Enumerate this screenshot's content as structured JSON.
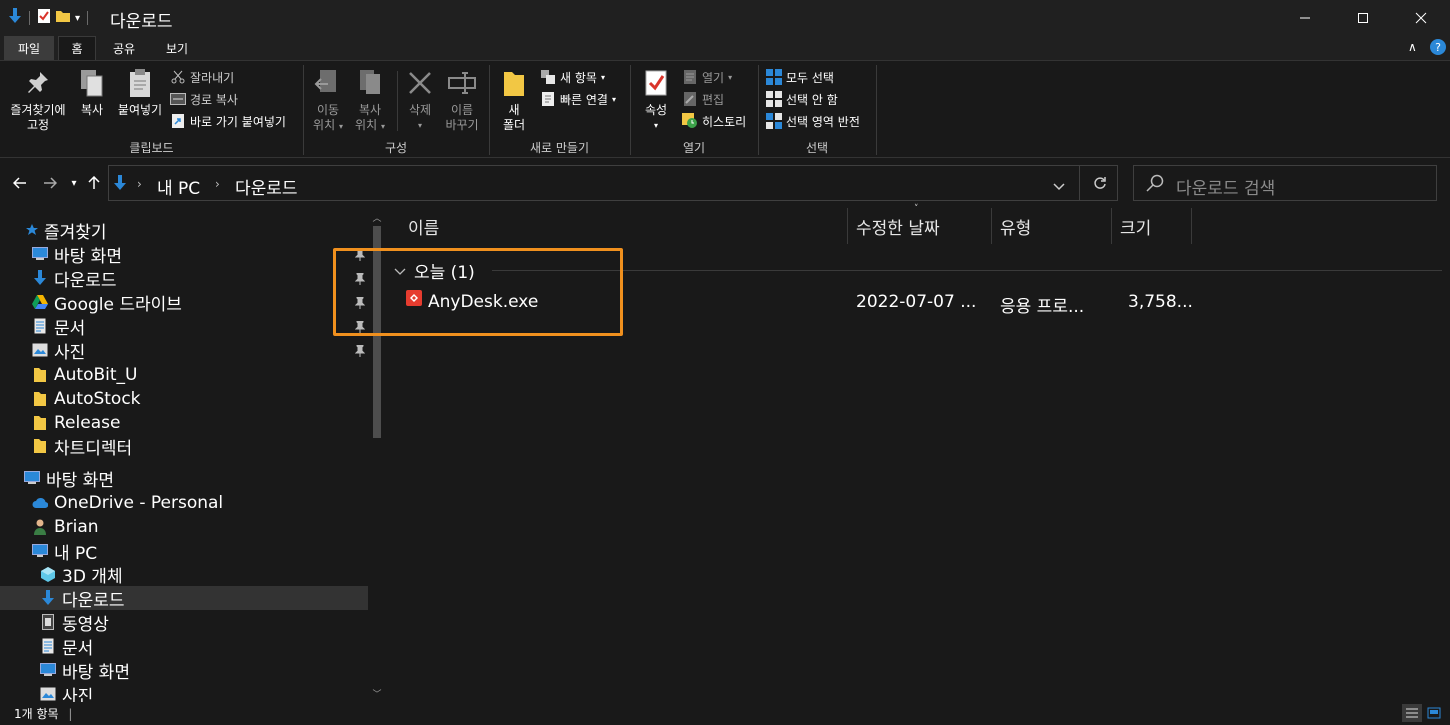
{
  "window": {
    "title": "다운로드"
  },
  "tabs": {
    "file": "파일",
    "home": "홈",
    "share": "공유",
    "view": "보기"
  },
  "ribbon": {
    "clipboard": {
      "label": "클립보드",
      "pin": "즐겨찾기에",
      "pin2": "고정",
      "copy": "복사",
      "paste": "붙여넣기",
      "cut": "잘라내기",
      "copy_path": "경로 복사",
      "paste_shortcut": "바로 가기 붙여넣기"
    },
    "organize": {
      "label": "구성",
      "move1": "이동",
      "move2": "위치",
      "copyto1": "복사",
      "copyto2": "위치",
      "delete": "삭제",
      "rename1": "이름",
      "rename2": "바꾸기"
    },
    "new": {
      "label": "새로 만들기",
      "new_folder1": "새",
      "new_folder2": "폴더",
      "new_item": "새 항목",
      "easy_access": "빠른 연결"
    },
    "open": {
      "label": "열기",
      "properties": "속성",
      "open": "열기",
      "edit": "편집",
      "history": "히스토리"
    },
    "select": {
      "label": "선택",
      "select_all": "모두 선택",
      "select_none": "선택 안 함",
      "invert": "선택 영역 반전"
    }
  },
  "address": {
    "crumbs": [
      "내 PC",
      "다운로드"
    ],
    "search_placeholder": "다운로드 검색"
  },
  "nav": {
    "quick_access": "즐겨찾기",
    "items": [
      {
        "label": "바탕 화면",
        "icon": "desktop-icon",
        "pinned": true
      },
      {
        "label": "다운로드",
        "icon": "download-icon",
        "pinned": true
      },
      {
        "label": "Google 드라이브",
        "icon": "google-drive-icon",
        "pinned": true
      },
      {
        "label": "문서",
        "icon": "document-icon",
        "pinned": true
      },
      {
        "label": "사진",
        "icon": "picture-icon",
        "pinned": true
      },
      {
        "label": "AutoBit_U",
        "icon": "folder-icon",
        "pinned": false
      },
      {
        "label": "AutoStock",
        "icon": "folder-icon",
        "pinned": false
      },
      {
        "label": "Release",
        "icon": "folder-icon",
        "pinned": false
      },
      {
        "label": "차트디렉터",
        "icon": "folder-icon",
        "pinned": false
      }
    ],
    "desktop": "바탕 화면",
    "onedrive": "OneDrive - Personal",
    "user": "Brian",
    "this_pc": "내 PC",
    "pc_items": [
      {
        "label": "3D 개체",
        "icon": "3d-objects-icon"
      },
      {
        "label": "다운로드",
        "icon": "download-icon"
      },
      {
        "label": "동영상",
        "icon": "video-icon"
      },
      {
        "label": "문서",
        "icon": "document-icon"
      },
      {
        "label": "바탕 화면",
        "icon": "desktop-icon"
      },
      {
        "label": "사진",
        "icon": "picture-icon"
      }
    ]
  },
  "filelist": {
    "columns": {
      "name": "이름",
      "date": "수정한 날짜",
      "type": "유형",
      "size": "크기"
    },
    "group": "오늘 (1)",
    "files": [
      {
        "name": "AnyDesk.exe",
        "date": "2022-07-07 ...",
        "type": "응용 프로...",
        "size": "3,758..."
      }
    ]
  },
  "status": {
    "count": "1개 항목"
  },
  "colors": {
    "highlight": "#f0901e",
    "accent": "#2b88d8",
    "folder": "#f2c744"
  }
}
